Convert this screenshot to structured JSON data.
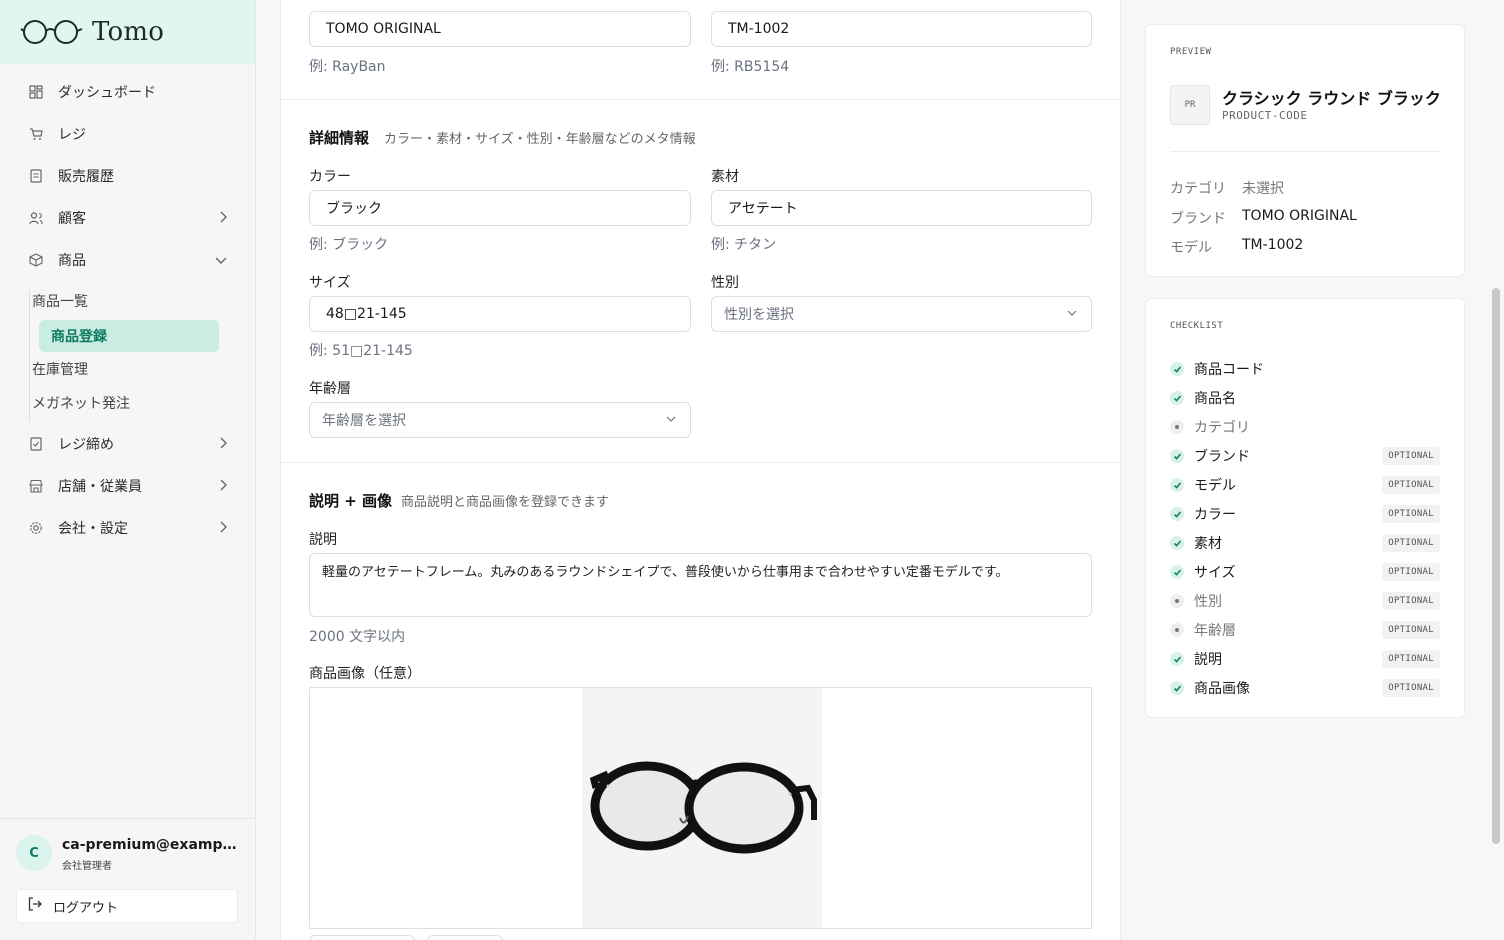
{
  "app": {
    "name": "Tomo"
  },
  "sidebar": {
    "items": [
      {
        "label": "ダッシュボード",
        "icon": "dashboard-icon"
      },
      {
        "label": "レジ",
        "icon": "cart-icon"
      },
      {
        "label": "販売履歴",
        "icon": "receipt-icon"
      },
      {
        "label": "顧客",
        "icon": "users-icon"
      },
      {
        "label": "商品",
        "icon": "box-icon"
      },
      {
        "label": "レジ締め",
        "icon": "register-close-icon"
      },
      {
        "label": "店舗・従業員",
        "icon": "store-icon"
      },
      {
        "label": "会社・設定",
        "icon": "gear-icon"
      }
    ],
    "sub_items": [
      "商品一覧",
      "商品登録",
      "在庫管理",
      "メガネット発注"
    ],
    "active_sub": "商品登録",
    "user": {
      "initial": "C",
      "email": "ca-premium@example.com",
      "role": "会社管理者"
    },
    "logout_label": "ログアウト"
  },
  "form": {
    "brand": {
      "value": "TOMO ORIGINAL",
      "hint": "例: RayBan"
    },
    "model": {
      "value": "TM-1002",
      "hint": "例: RB5154"
    },
    "details": {
      "title": "詳細情報",
      "desc": "カラー・素材・サイズ・性別・年齢層などのメタ情報",
      "color_label": "カラー",
      "color_value": "ブラック",
      "color_hint": "例: ブラック",
      "material_label": "素材",
      "material_value": "アセテート",
      "material_hint": "例: チタン",
      "size_label": "サイズ",
      "size_value": "48□21-145",
      "size_hint": "例: 51□21-145",
      "gender_label": "性別",
      "gender_placeholder": "性別を選択",
      "age_label": "年齢層",
      "age_placeholder": "年齢層を選択"
    },
    "description": {
      "title": "説明 + 画像",
      "desc": "商品説明と商品画像を登録できます",
      "label": "説明",
      "value": "軽量のアセテートフレーム。丸みのあるラウンドシェイプで、普段使いから仕事用まで合わせやすい定番モデルです。",
      "hint": "2000 文字以内",
      "image_label": "商品画像（任意）"
    }
  },
  "preview": {
    "label": "PREVIEW",
    "badge": "PR",
    "name": "クラシック ラウンド ブラック",
    "code": "PRODUCT-CODE",
    "rows": [
      {
        "k": "カテゴリ",
        "v": "未選択",
        "muted": true
      },
      {
        "k": "ブランド",
        "v": "TOMO ORIGINAL",
        "muted": false
      },
      {
        "k": "モデル",
        "v": "TM-1002",
        "muted": false
      }
    ]
  },
  "checklist": {
    "label": "CHECKLIST",
    "optional_label": "OPTIONAL",
    "items": [
      {
        "label": "商品コード",
        "done": true,
        "optional": false
      },
      {
        "label": "商品名",
        "done": true,
        "optional": false
      },
      {
        "label": "カテゴリ",
        "done": false,
        "optional": false
      },
      {
        "label": "ブランド",
        "done": true,
        "optional": true
      },
      {
        "label": "モデル",
        "done": true,
        "optional": true
      },
      {
        "label": "カラー",
        "done": true,
        "optional": true
      },
      {
        "label": "素材",
        "done": true,
        "optional": true
      },
      {
        "label": "サイズ",
        "done": true,
        "optional": true
      },
      {
        "label": "性別",
        "done": false,
        "optional": true
      },
      {
        "label": "年齢層",
        "done": false,
        "optional": true
      },
      {
        "label": "説明",
        "done": true,
        "optional": true
      },
      {
        "label": "商品画像",
        "done": true,
        "optional": true
      }
    ]
  },
  "colors": {
    "accent": "#0f7a63",
    "accent_bg": "#c9eee1",
    "logo_bg": "#e1f6ef"
  }
}
